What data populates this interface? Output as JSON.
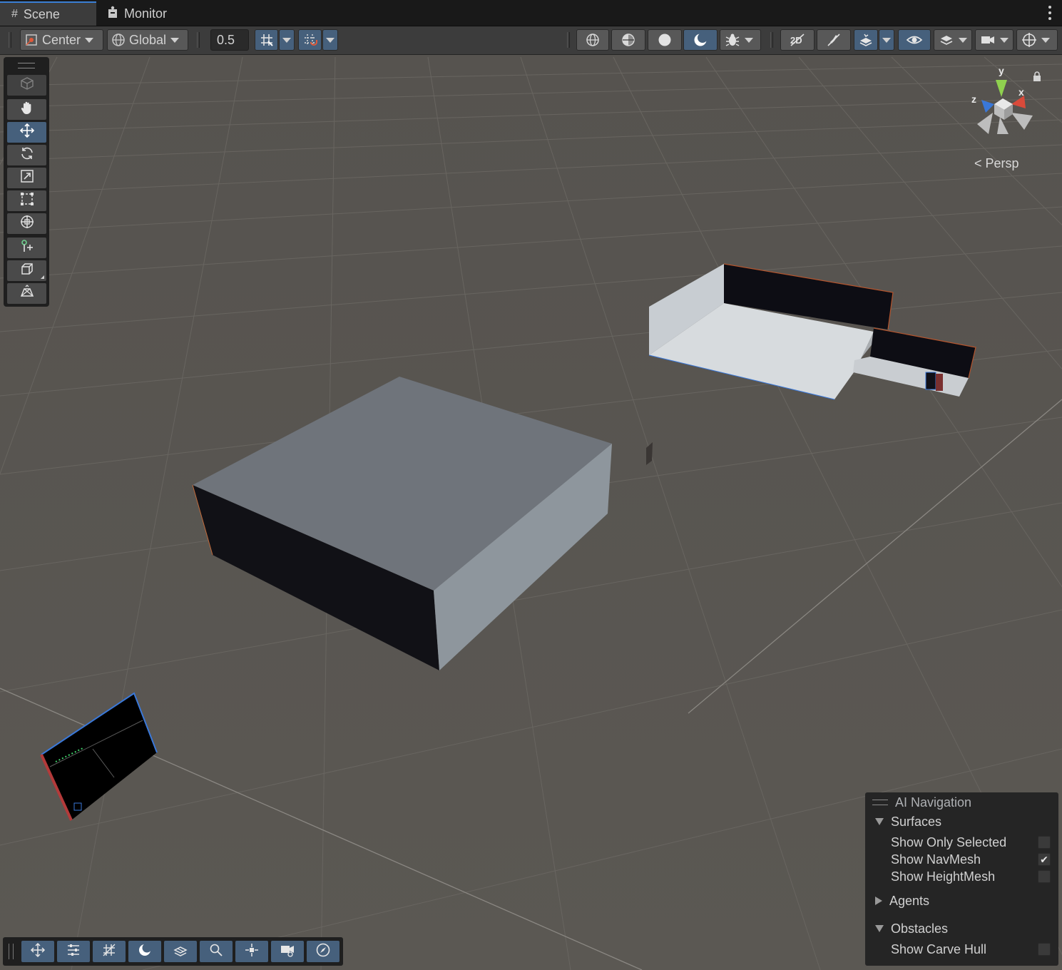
{
  "tabs": [
    {
      "label": "Scene",
      "icon": "scene-grid-icon",
      "active": true
    },
    {
      "label": "Monitor",
      "icon": "monitor-icon",
      "active": false
    }
  ],
  "toolbar": {
    "pivot_mode": "Center",
    "pivot_rotation": "Global",
    "grid_snap_value": "0.5"
  },
  "tool_palette": [
    "view-cube-icon",
    "hand-tool-icon",
    "move-tool-icon",
    "rotate-tool-icon",
    "scale-tool-icon",
    "rect-tool-icon",
    "transform-tool-icon",
    "custom-tool-icon",
    "probuilder-icon",
    "navmesh-tool-icon"
  ],
  "gizmo": {
    "projection": "Persp",
    "axes": {
      "x": "x",
      "y": "y",
      "z": "z"
    },
    "colors": {
      "x": "#d94a3a",
      "y": "#8fd14f",
      "z": "#3a78d9"
    }
  },
  "ai_navigation": {
    "title": "AI Navigation",
    "surfaces": {
      "label": "Surfaces",
      "show_only_selected": {
        "label": "Show Only Selected",
        "checked": false
      },
      "show_navmesh": {
        "label": "Show NavMesh",
        "checked": true
      },
      "show_heightmesh": {
        "label": "Show HeightMesh",
        "checked": false
      }
    },
    "agents": {
      "label": "Agents"
    },
    "obstacles": {
      "label": "Obstacles",
      "show_carve_hull": {
        "label": "Show Carve Hull",
        "checked": false
      }
    }
  },
  "colors": {
    "accent": "#46607c",
    "tab_highlight": "#3a7fd5",
    "viewport_bg": "#5a5752"
  }
}
